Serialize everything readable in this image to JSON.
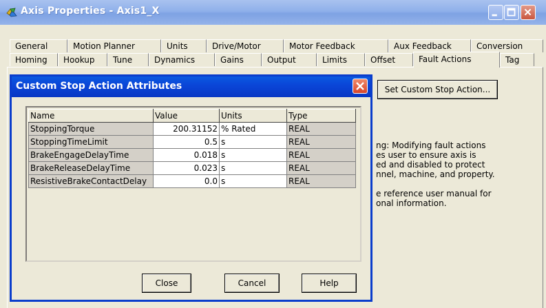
{
  "window": {
    "title": "Axis Properties - Axis1_X"
  },
  "tabs": {
    "row1": [
      "General",
      "Motion Planner",
      "Units",
      "Drive/Motor",
      "Motor Feedback",
      "Aux Feedback",
      "Conversion"
    ],
    "row2": [
      "Homing",
      "Hookup",
      "Tune",
      "Dynamics",
      "Gains",
      "Output",
      "Limits",
      "Offset",
      "Fault Actions",
      "Tag"
    ],
    "active": "Fault Actions"
  },
  "fault_actions": {
    "set_custom_stop_action_label": "Set Custom Stop Action...",
    "warning_lines": [
      "ng: Modifying fault actions",
      "es user to ensure axis is",
      "ed and disabled to protect",
      "nnel, machine, and property.",
      "",
      "e reference user manual for",
      "onal information."
    ]
  },
  "dialog": {
    "title": "Custom Stop Action Attributes",
    "columns": [
      "Name",
      "Value",
      "Units",
      "Type"
    ],
    "rows": [
      {
        "name": "StoppingTorque",
        "value": "200.31152",
        "units": "% Rated",
        "type": "REAL"
      },
      {
        "name": "StoppingTimeLimit",
        "value": "0.5",
        "units": "s",
        "type": "REAL"
      },
      {
        "name": "BrakeEngageDelayTime",
        "value": "0.018",
        "units": "s",
        "type": "REAL"
      },
      {
        "name": "BrakeReleaseDelayTime",
        "value": "0.023",
        "units": "s",
        "type": "REAL"
      },
      {
        "name": "ResistiveBrakeContactDelay",
        "value": "0.0",
        "units": "s",
        "type": "REAL"
      }
    ],
    "buttons": {
      "close": "Close",
      "cancel": "Cancel",
      "help": "Help"
    }
  },
  "colors": {
    "window_title_bar": "#8fb0ea",
    "dialog_title_bar": "#0a46d8",
    "close_button": "#d8452a",
    "face": "#ece9d8"
  }
}
